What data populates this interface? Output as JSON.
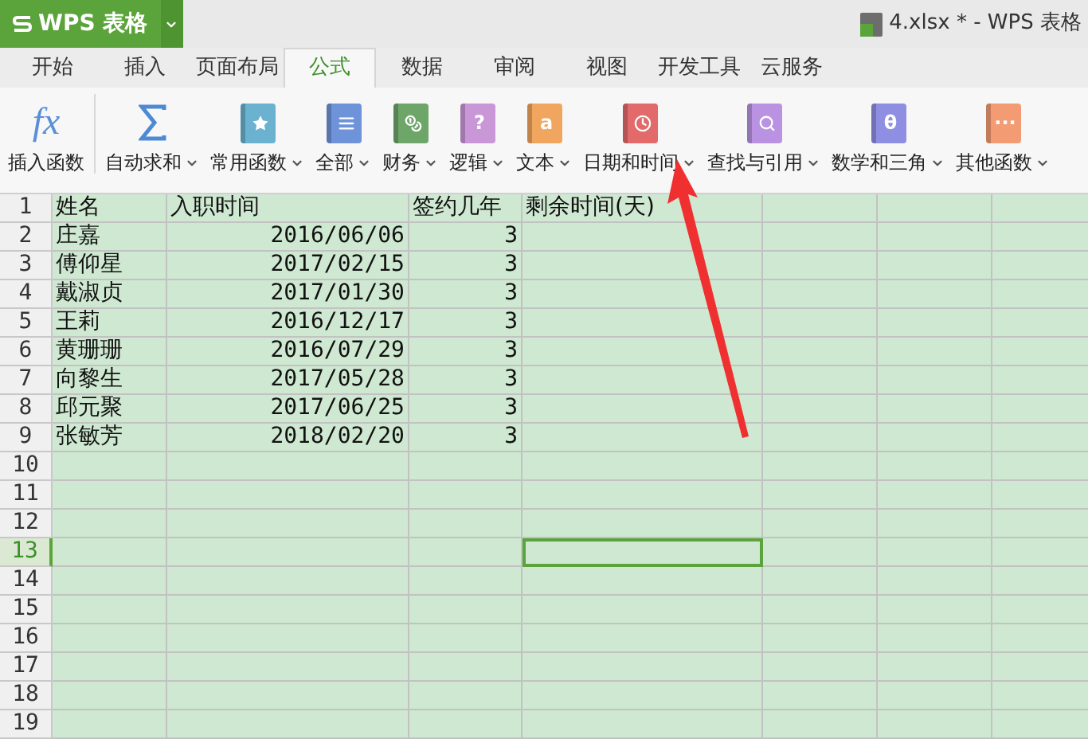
{
  "app_button": {
    "label": "WPS 表格"
  },
  "document_title": "4.xlsx * - WPS 表格",
  "tabs": [
    {
      "label": "开始",
      "selected": false
    },
    {
      "label": "插入",
      "selected": false
    },
    {
      "label": "页面布局",
      "selected": false
    },
    {
      "label": "公式",
      "selected": true
    },
    {
      "label": "数据",
      "selected": false
    },
    {
      "label": "审阅",
      "selected": false
    },
    {
      "label": "视图",
      "selected": false
    },
    {
      "label": "开发工具",
      "selected": false
    },
    {
      "label": "云服务",
      "selected": false
    }
  ],
  "ribbon": [
    {
      "label": "插入函数",
      "kind": "fx",
      "dropdown": false
    },
    {
      "label": "自动求和",
      "kind": "sigma",
      "dropdown": true
    },
    {
      "label": "常用函数",
      "kind": "star",
      "color": "#6ab2cf",
      "dropdown": true
    },
    {
      "label": "全部",
      "kind": "list",
      "color": "#6f93d9",
      "dropdown": true
    },
    {
      "label": "财务",
      "kind": "coins",
      "color": "#6ea66a",
      "dropdown": true
    },
    {
      "label": "逻辑",
      "kind": "glyph",
      "glyph": "?",
      "color": "#c996d8",
      "dropdown": true
    },
    {
      "label": "文本",
      "kind": "glyph",
      "glyph": "a",
      "color": "#f0a65e",
      "dropdown": true
    },
    {
      "label": "日期和时间",
      "kind": "clock",
      "color": "#e26a6a",
      "dropdown": true
    },
    {
      "label": "查找与引用",
      "kind": "search",
      "color": "#b993e2",
      "dropdown": true
    },
    {
      "label": "数学和三角",
      "kind": "glyph",
      "glyph": "θ",
      "color": "#8e8fe2",
      "dropdown": true
    },
    {
      "label": "其他函数",
      "kind": "glyph",
      "glyph": "···",
      "color": "#f39b72",
      "dropdown": true
    }
  ],
  "columns": [
    {
      "selected": false
    },
    {
      "selected": false
    },
    {
      "selected": false
    },
    {
      "selected": true
    },
    {
      "selected": false
    },
    {
      "selected": false
    },
    {
      "selected": false
    }
  ],
  "rows": [
    {
      "number": "1",
      "selected": false,
      "values": [
        "姓名",
        "入职时间",
        "签约几年",
        "剩余时间(天)"
      ]
    },
    {
      "number": "2",
      "selected": false,
      "values": [
        "庄嘉",
        "2016/06/06",
        "3"
      ]
    },
    {
      "number": "3",
      "selected": false,
      "values": [
        "傅仰星",
        "2017/02/15",
        "3"
      ]
    },
    {
      "number": "4",
      "selected": false,
      "values": [
        "戴淑贞",
        "2017/01/30",
        "3"
      ]
    },
    {
      "number": "5",
      "selected": false,
      "values": [
        "王莉",
        "2016/12/17",
        "3"
      ]
    },
    {
      "number": "6",
      "selected": false,
      "values": [
        "黄珊珊",
        "2016/07/29",
        "3"
      ]
    },
    {
      "number": "7",
      "selected": false,
      "values": [
        "向黎生",
        "2017/05/28",
        "3"
      ]
    },
    {
      "number": "8",
      "selected": false,
      "values": [
        "邱元聚",
        "2017/06/25",
        "3"
      ]
    },
    {
      "number": "9",
      "selected": false,
      "values": [
        "张敏芳",
        "2018/02/20",
        "3"
      ]
    },
    {
      "number": "10",
      "selected": false
    },
    {
      "number": "11",
      "selected": false
    },
    {
      "number": "12",
      "selected": false
    },
    {
      "number": "13",
      "selected": true
    },
    {
      "number": "14",
      "selected": false
    },
    {
      "number": "15",
      "selected": false
    },
    {
      "number": "16",
      "selected": false
    },
    {
      "number": "17",
      "selected": false
    },
    {
      "number": "18",
      "selected": false
    },
    {
      "number": "19",
      "selected": false
    }
  ]
}
